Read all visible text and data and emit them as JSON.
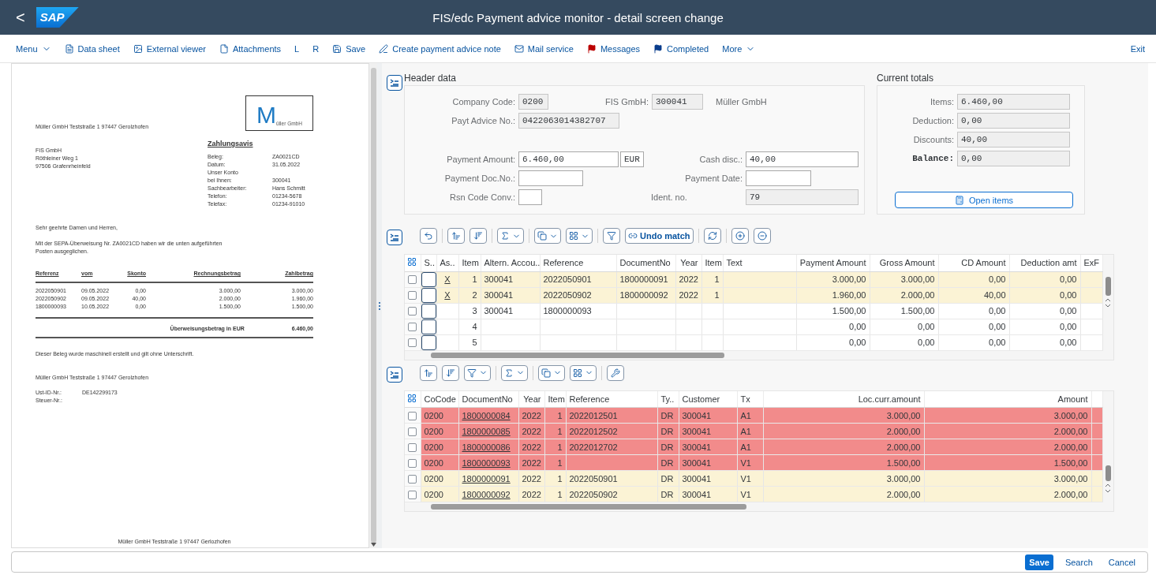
{
  "shell": {
    "back": "<",
    "logo": "SAP",
    "title": "FIS/edc Payment advice monitor - detail screen change"
  },
  "toolbar": {
    "items": [
      {
        "label": "Menu",
        "kind": "menu"
      },
      {
        "label": "Data sheet",
        "kind": "sheet"
      },
      {
        "label": "External viewer",
        "kind": "viewer"
      },
      {
        "label": "Attachments",
        "kind": "attachments"
      },
      {
        "label": "L",
        "kind": "plain"
      },
      {
        "label": "R",
        "kind": "plain"
      },
      {
        "label": "Save",
        "kind": "save"
      },
      {
        "label": "Create payment advice note",
        "kind": "create"
      },
      {
        "label": "Mail service",
        "kind": "mail"
      },
      {
        "label": "Messages",
        "kind": "flag",
        "color": "#bb0000"
      },
      {
        "label": "Completed",
        "kind": "flag",
        "color": "#0a3d8c"
      },
      {
        "label": "More",
        "kind": "menu"
      }
    ],
    "exit": "Exit"
  },
  "document": {
    "sender": "Müller GmbH Teststraße 1 97447 Gerolzhofen",
    "logo": {
      "initial": "M",
      "name": "üller GmbH"
    },
    "recipient": [
      "FIS GmbH",
      "Röthleiner Weg 1",
      "97506 Grafenrheinfeld"
    ],
    "title": "Zahlungsavis",
    "info": [
      {
        "label": "Beleg:",
        "value": "ZA0021CD"
      },
      {
        "label": "Datum:",
        "value": "31.05.2022"
      },
      {
        "label": "Unser Konto"
      },
      {
        "label": "bei Ihnen:",
        "value": "300041"
      },
      {
        "label": "Sachbearbeiter:",
        "value": "Hans Schmitt"
      },
      {
        "label": "Telefon:",
        "value": "01234-5678"
      },
      {
        "label": "Telefax:",
        "value": "01234-91010"
      }
    ],
    "salutation": "Sehr geehrte Damen und Herren,",
    "body": [
      "Mit der SEPA-Überweisung Nr. ZA0021CD haben wir die unten aufgeführten",
      "Posten ausgeglichen."
    ],
    "columns": [
      "Referenz",
      "vom",
      "Skonto",
      "Rechnungsbetrag",
      "Zahlbetrag"
    ],
    "rows": [
      [
        "2022050901",
        "09.05.2022",
        "0,00",
        "3.000,00",
        "3.000,00"
      ],
      [
        "2022050902",
        "09.05.2022",
        "40,00",
        "2.000,00",
        "1.960,00"
      ],
      [
        "1800000093",
        "10.05.2022",
        "0,00",
        "1.500,00",
        "1.500,00"
      ]
    ],
    "total_label": "Überweisungsbetrag in EUR",
    "total": "6.460,00",
    "note": "Dieser Beleg wurde maschinell erstellt und gilt ohne Unterschrift.",
    "company": "Müller GmbH Teststraße 1 97447 Gerolzhofen",
    "tax": [
      {
        "label": "Ust-ID-Nr.:",
        "value": "DE142299173"
      },
      {
        "label": "Steuer-Nr.:"
      }
    ],
    "footer": "Müller GmbH Teststraße 1 97447 Gerlozhofen"
  },
  "header_data": {
    "title": "Header data",
    "fields": [
      {
        "label": "Company Code:",
        "value": "0200",
        "editable": false
      },
      {
        "label": "FIS GmbH:",
        "value": "300041",
        "editable": false,
        "description": "Müller GmbH"
      },
      {
        "label": "Payt Advice No.:",
        "value": "0422063014382707",
        "editable": false
      },
      {
        "label": "Payment Amount:",
        "value": "6.460,00",
        "editable": true,
        "unit": "EUR"
      },
      {
        "label": "Cash disc.:",
        "value": "40,00",
        "editable": true
      },
      {
        "label": "Payment Doc.No.:",
        "editable": true
      },
      {
        "label": "Payment Date:",
        "editable": true
      },
      {
        "label": "Rsn Code Conv.:",
        "editable": true
      },
      {
        "label": "Ident. no.",
        "value": "79",
        "editable": false
      }
    ]
  },
  "totals": {
    "title": "Current totals",
    "fields": [
      {
        "label": "Items:",
        "value": "6.460,00",
        "emphasized": false
      },
      {
        "label": "Deduction:",
        "value": "0,00",
        "emphasized": false
      },
      {
        "label": "Discounts:",
        "value": "40,00",
        "emphasized": false
      },
      {
        "label": "Balance:",
        "value": "0,00",
        "emphasized": true
      }
    ],
    "button": "Open items"
  },
  "items_table": {
    "undo_button": "Undo match",
    "columns": [
      {
        "label": "S..",
        "kind": "status"
      },
      {
        "label": "As..",
        "kind": "link"
      },
      {
        "label": "Item",
        "kind": "number"
      },
      {
        "label": "Altern. Accou..",
        "kind": "text"
      },
      {
        "label": "Reference",
        "kind": "text"
      },
      {
        "label": "DocumentNo",
        "kind": "text"
      },
      {
        "label": "Year",
        "kind": "number"
      },
      {
        "label": "Item",
        "kind": "number"
      },
      {
        "label": "Text",
        "kind": "text"
      },
      {
        "label": "Payment Amount",
        "kind": "number"
      },
      {
        "label": "Gross Amount",
        "kind": "number"
      },
      {
        "label": "CD Amount",
        "kind": "number"
      },
      {
        "label": "Deduction amt",
        "kind": "number"
      },
      {
        "label": "ExF",
        "kind": "text"
      }
    ],
    "rows": [
      {
        "checked": false,
        "highlighted": true,
        "cells": [
          null,
          "X",
          "1",
          "300041",
          "2022050901",
          "1800000091",
          "2022",
          "1",
          null,
          "3.000,00",
          "3.000,00",
          "0,00",
          "0,00",
          null
        ]
      },
      {
        "checked": false,
        "highlighted": true,
        "cells": [
          null,
          "X",
          "2",
          "300041",
          "2022050902",
          "1800000092",
          "2022",
          "1",
          null,
          "1.960,00",
          "2.000,00",
          "40,00",
          "0,00",
          null
        ]
      },
      {
        "checked": false,
        "highlighted": false,
        "cells": [
          null,
          null,
          "3",
          "300041",
          "1800000093",
          null,
          null,
          null,
          null,
          "1.500,00",
          "1.500,00",
          "0,00",
          "0,00",
          null
        ]
      },
      {
        "checked": false,
        "highlighted": false,
        "cells": [
          null,
          null,
          "4",
          null,
          null,
          null,
          null,
          null,
          null,
          "0,00",
          "0,00",
          "0,00",
          "0,00",
          null
        ]
      },
      {
        "checked": false,
        "highlighted": false,
        "cells": [
          null,
          null,
          "5",
          null,
          null,
          null,
          null,
          null,
          null,
          "0,00",
          "0,00",
          "0,00",
          "0,00",
          null
        ]
      }
    ]
  },
  "open_items_table": {
    "columns": [
      {
        "label": "CoCode",
        "kind": "text"
      },
      {
        "label": "DocumentNo",
        "kind": "link"
      },
      {
        "label": "Year",
        "kind": "number"
      },
      {
        "label": "Item",
        "kind": "number"
      },
      {
        "label": "Reference",
        "kind": "text"
      },
      {
        "label": "Ty..",
        "kind": "text"
      },
      {
        "label": "Customer",
        "kind": "text"
      },
      {
        "label": "Tx",
        "kind": "text"
      },
      {
        "label": "Loc.curr.amount",
        "kind": "number"
      },
      {
        "label": "Amount",
        "kind": "number"
      }
    ],
    "rows": [
      {
        "checked": false,
        "color": "#f28b8b",
        "cells": [
          "0200",
          "1800000084",
          "2022",
          "1",
          "2022012501",
          "DR",
          "300041",
          "A1",
          "3.000,00",
          "3.000,00"
        ]
      },
      {
        "checked": false,
        "color": "#f28b8b",
        "cells": [
          "0200",
          "1800000085",
          "2022",
          "1",
          "2022012502",
          "DR",
          "300041",
          "A1",
          "2.000,00",
          "2.000,00"
        ]
      },
      {
        "checked": false,
        "color": "#f28b8b",
        "cells": [
          "0200",
          "1800000086",
          "2022",
          "1",
          "2022012702",
          "DR",
          "300041",
          "A1",
          "2.000,00",
          "2.000,00"
        ]
      },
      {
        "checked": false,
        "color": "#f28b8b",
        "cells": [
          "0200",
          "1800000093",
          "2022",
          "1",
          null,
          "DR",
          "300041",
          "V1",
          "1.500,00",
          "1.500,00"
        ]
      },
      {
        "checked": false,
        "color": "#fbf3d5",
        "cells": [
          "0200",
          "1800000091",
          "2022",
          "1",
          "2022050901",
          "DR",
          "300041",
          "V1",
          "3.000,00",
          "3.000,00"
        ]
      },
      {
        "checked": false,
        "color": "#fbf3d5",
        "cells": [
          "0200",
          "1800000092",
          "2022",
          "1",
          "2022050902",
          "DR",
          "300041",
          "V1",
          "2.000,00",
          "2.000,00"
        ]
      }
    ]
  },
  "footer": {
    "buttons": [
      {
        "label": "Save",
        "emphasized": true
      },
      {
        "label": "Search",
        "emphasized": false
      },
      {
        "label": "Cancel",
        "emphasized": false
      }
    ]
  }
}
